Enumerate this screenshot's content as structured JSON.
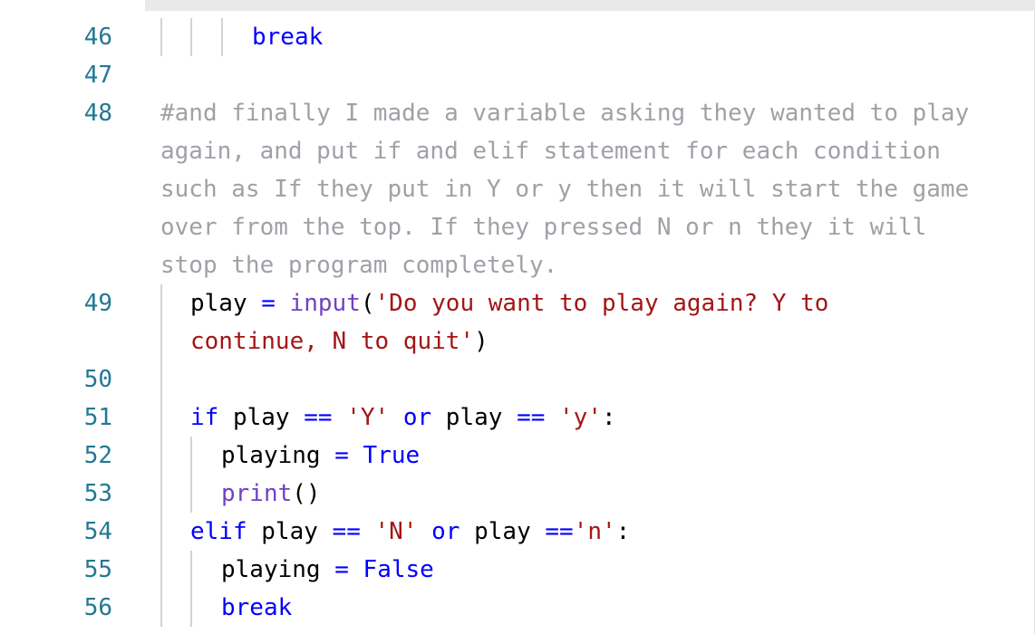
{
  "editor": {
    "lines": [
      {
        "num": "46",
        "tokens": [
          {
            "t": "break",
            "c": "kw"
          }
        ]
      },
      {
        "num": "47",
        "tokens": []
      },
      {
        "num": "48",
        "tokens": [
          {
            "t": "#and finally I made a variable asking they wanted to play again, and put if and elif statement for each condition such as If they put in Y or y then it will start the game over from the top. If they pressed N or n they it will stop the program completely.",
            "c": "comment"
          }
        ]
      },
      {
        "num": "49",
        "tokens": [
          {
            "t": "play ",
            "c": "plain"
          },
          {
            "t": "=",
            "c": "op"
          },
          {
            "t": " ",
            "c": "plain"
          },
          {
            "t": "input",
            "c": "fn"
          },
          {
            "t": "(",
            "c": "plain"
          },
          {
            "t": "'Do you want to play again? Y to continue, N to quit'",
            "c": "str"
          },
          {
            "t": ")",
            "c": "plain"
          }
        ]
      },
      {
        "num": "50",
        "tokens": []
      },
      {
        "num": "51",
        "tokens": [
          {
            "t": "if",
            "c": "kw"
          },
          {
            "t": " play ",
            "c": "plain"
          },
          {
            "t": "==",
            "c": "op"
          },
          {
            "t": " ",
            "c": "plain"
          },
          {
            "t": "'Y'",
            "c": "str"
          },
          {
            "t": " ",
            "c": "plain"
          },
          {
            "t": "or",
            "c": "kw"
          },
          {
            "t": " play ",
            "c": "plain"
          },
          {
            "t": "==",
            "c": "op"
          },
          {
            "t": " ",
            "c": "plain"
          },
          {
            "t": "'y'",
            "c": "str"
          },
          {
            "t": ":",
            "c": "plain"
          }
        ]
      },
      {
        "num": "52",
        "tokens": [
          {
            "t": "playing ",
            "c": "plain"
          },
          {
            "t": "=",
            "c": "op"
          },
          {
            "t": " ",
            "c": "plain"
          },
          {
            "t": "True",
            "c": "kw"
          }
        ]
      },
      {
        "num": "53",
        "tokens": [
          {
            "t": "print",
            "c": "fn"
          },
          {
            "t": "()",
            "c": "plain"
          }
        ]
      },
      {
        "num": "54",
        "tokens": [
          {
            "t": "elif",
            "c": "kw"
          },
          {
            "t": " play ",
            "c": "plain"
          },
          {
            "t": "==",
            "c": "op"
          },
          {
            "t": " ",
            "c": "plain"
          },
          {
            "t": "'N'",
            "c": "str"
          },
          {
            "t": " ",
            "c": "plain"
          },
          {
            "t": "or",
            "c": "kw"
          },
          {
            "t": " play ",
            "c": "plain"
          },
          {
            "t": "==",
            "c": "op"
          },
          {
            "t": "'n'",
            "c": "str"
          },
          {
            "t": ":",
            "c": "plain"
          }
        ]
      },
      {
        "num": "55",
        "tokens": [
          {
            "t": "playing ",
            "c": "plain"
          },
          {
            "t": "=",
            "c": "op"
          },
          {
            "t": " ",
            "c": "plain"
          },
          {
            "t": "False",
            "c": "kw"
          }
        ]
      },
      {
        "num": "56",
        "tokens": [
          {
            "t": "break",
            "c": "kw"
          }
        ]
      }
    ]
  }
}
